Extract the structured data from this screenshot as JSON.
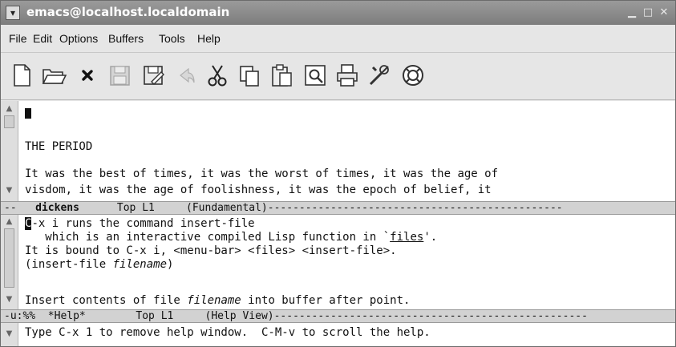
{
  "window": {
    "title": "emacs@localhost.localdomain",
    "menu_icon": "chevron-down-icon",
    "minimize": "▁",
    "maximize": "□",
    "close": "✕"
  },
  "menubar": {
    "items": [
      "File",
      "Edit",
      "Options",
      "Buffers",
      "Tools",
      "Help"
    ]
  },
  "toolbar": {
    "buttons": [
      "new-file-icon",
      "open-folder-icon",
      "close-icon",
      "save-icon",
      "save-as-icon",
      "undo-icon",
      "cut-icon",
      "copy-icon",
      "paste-icon",
      "search-icon",
      "print-icon",
      "preferences-icon",
      "help-icon"
    ]
  },
  "top_buffer": {
    "lines": [
      "",
      "",
      "THE PERIOD",
      "",
      "It was the best of times, it was the worst of times, it was the age of",
      "visdom, it was the age of foolishness, it was the epoch of belief, it"
    ]
  },
  "modeline_top": {
    "prefix": "--",
    "buffer": "dickens",
    "position": "Top L1",
    "mode": "(Fundamental)"
  },
  "help_buffer": {
    "line1_rest": "-x i runs the command insert-file",
    "line1_first": "C",
    "line2_pre": "   which is an interactive compiled Lisp function in `",
    "line2_link": "files",
    "line2_post": "'.",
    "line3": "It is bound to C-x i, <menu-bar> <files> <insert-file>.",
    "line4_pre": "(insert-file ",
    "line4_em": "filename",
    "line4_post": ")",
    "line6_pre": "Insert contents of file ",
    "line6_em": "filename",
    "line6_post": " into buffer after point."
  },
  "modeline_help": {
    "prefix": "-u:%%",
    "buffer": "*Help*",
    "position": "Top L1",
    "mode": "(Help View)"
  },
  "minibuffer": {
    "text": "Type C-x 1 to remove help window.  C-M-v to scroll the help."
  }
}
